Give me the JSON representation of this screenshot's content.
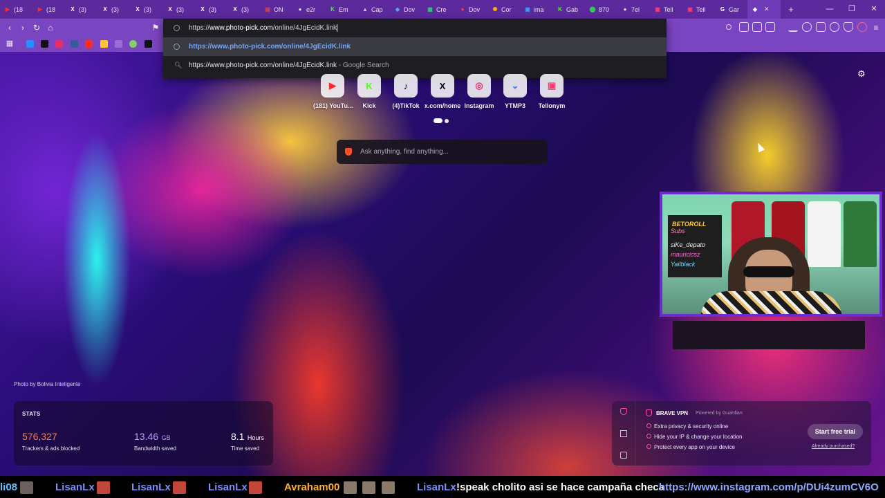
{
  "browser": {
    "tabs": [
      {
        "label": "(18",
        "icon": "youtube-icon",
        "color": "#ff2a2a"
      },
      {
        "label": "(18",
        "icon": "youtube-icon",
        "color": "#ff2a2a"
      },
      {
        "label": "(3)",
        "icon": "x-icon",
        "color": "#ffffff"
      },
      {
        "label": "(3)",
        "icon": "x-icon",
        "color": "#ffffff"
      },
      {
        "label": "(3)",
        "icon": "x-icon",
        "color": "#ffffff"
      },
      {
        "label": "(3)",
        "icon": "x-icon",
        "color": "#ffffff"
      },
      {
        "label": "(3)",
        "icon": "x-icon",
        "color": "#ffffff"
      },
      {
        "label": "(3)",
        "icon": "x-icon",
        "color": "#ffffff"
      },
      {
        "label": "ON",
        "icon": "page-icon",
        "color": "#e04848"
      },
      {
        "label": "e2r",
        "icon": "globe-icon",
        "color": "#dddddd"
      },
      {
        "label": "Em",
        "icon": "kick-icon",
        "color": "#53fc18"
      },
      {
        "label": "Cap",
        "icon": "cap-icon",
        "color": "#c8c8c8"
      },
      {
        "label": "Dov",
        "icon": "gem-icon",
        "color": "#5aa0ff"
      },
      {
        "label": "Cre",
        "icon": "grid-icon",
        "color": "#2ecc71"
      },
      {
        "label": "Dov",
        "icon": "circle-icon",
        "color": "#ff3b3b"
      },
      {
        "label": "Cor",
        "icon": "spinner-icon",
        "color": "#ffb400"
      },
      {
        "label": "ima",
        "icon": "image-icon",
        "color": "#3aa0ff"
      },
      {
        "label": "Gab",
        "icon": "kick-icon",
        "color": "#53fc18"
      },
      {
        "label": "870",
        "icon": "map-pin-icon",
        "color": "#34c759"
      },
      {
        "label": "7el",
        "icon": "globe-icon",
        "color": "#dddddd"
      },
      {
        "label": "Tell",
        "icon": "tellonym-icon",
        "color": "#ff3a6e"
      },
      {
        "label": "Tell",
        "icon": "tellonym-icon",
        "color": "#ff3a6e"
      },
      {
        "label": "Gar",
        "icon": "google-icon",
        "color": "#ffffff"
      }
    ],
    "active_tab_icon": "brave-shield-icon",
    "new_tab": "+",
    "window_controls": {
      "minimize": "—",
      "maximize": "❐",
      "close": "✕"
    }
  },
  "omnibox": {
    "input_prefix": "https://",
    "input_host": "www.photo-pick.com",
    "input_path": "/online/4JgEcidK.link",
    "suggestion_url": "https://www.photo-pick.com/online/4JgEcidK.link",
    "search_query": "https://www.photo-pick.com/online/4JgEcidK.link",
    "search_suffix": " - Google Search"
  },
  "top_sites": [
    {
      "label": "(181) YouTu...",
      "glyph": "▶",
      "color": "#ff2a2a",
      "icon": "youtube-icon"
    },
    {
      "label": "Kick",
      "glyph": "K",
      "color": "#53fc18",
      "icon": "kick-icon"
    },
    {
      "label": "(4)TikTok",
      "glyph": "♪",
      "color": "#000000",
      "icon": "tiktok-icon"
    },
    {
      "label": "x.com/home",
      "glyph": "X",
      "color": "#000000",
      "icon": "x-icon"
    },
    {
      "label": "Instagram",
      "glyph": "◎",
      "color": "#e1306c",
      "icon": "instagram-icon"
    },
    {
      "label": "YTMP3",
      "glyph": "⌄",
      "color": "#2f6bff",
      "icon": "ytmp3-icon"
    },
    {
      "label": "Tellonym",
      "glyph": "▣",
      "color": "#ff3a6e",
      "icon": "tellonym-icon"
    }
  ],
  "search": {
    "placeholder": "Ask anything, find anything..."
  },
  "photo_credit": "Photo by Bolivia Inteligente",
  "stats": {
    "heading": "STATS",
    "trackers_value": "576,327",
    "trackers_label": "Trackers & ads blocked",
    "bandwidth_value": "13.46",
    "bandwidth_unit": "GB",
    "bandwidth_label": "Bandwidth saved",
    "time_value": "8.1",
    "time_unit": "Hours",
    "time_label": "Time saved",
    "trackers_color": "#ff7a3d",
    "bandwidth_color": "#b6a2ff"
  },
  "vpn": {
    "title": "BRAVE VPN",
    "powered_by": "Powered by  Guardian",
    "features": [
      "Extra privacy & security online",
      "Hide your IP & change your location",
      "Protect every app on your device"
    ],
    "cta": "Start free trial",
    "already_purchased": "Already purchased?"
  },
  "stream_overlay": {
    "board_lines": [
      "BETOROLL",
      "Subs",
      "siKe_depato",
      "mauricicsz",
      "Yailblack"
    ]
  },
  "chat_ticker": [
    {
      "text": "li08",
      "color": "#5fc2ff"
    },
    {
      "text": "LisanLx",
      "color": "#7a8cff"
    },
    {
      "text": "LisanLx",
      "color": "#7a8cff"
    },
    {
      "text": "LisanLx",
      "color": "#7a8cff"
    },
    {
      "text": "Avraham00",
      "color": "#ffae2b"
    },
    {
      "text": "LisanLx",
      "color": "#7a8cff"
    },
    {
      "text": "!speak cholito asi se hace campaña checa ",
      "color": "#ffffff"
    },
    {
      "text": "https://www.instagram.com/p/DUi4zumCV6O",
      "color": "#8fa8ff"
    }
  ]
}
